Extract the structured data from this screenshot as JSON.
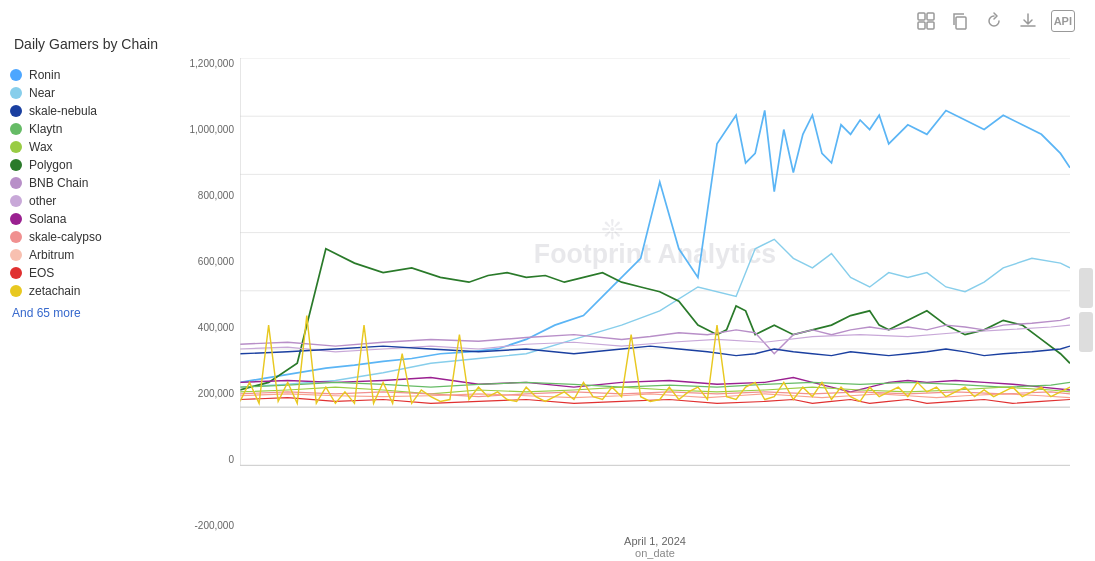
{
  "title": "Daily Gamers by Chain",
  "toolbar": {
    "icons": [
      "table-icon",
      "copy-icon",
      "refresh-icon",
      "download-icon",
      "api-icon"
    ]
  },
  "legend": {
    "items": [
      {
        "label": "Ronin",
        "color": "#4da6ff",
        "id": "ronin"
      },
      {
        "label": "Near",
        "color": "#87ceeb",
        "id": "near"
      },
      {
        "label": "skale-nebula",
        "color": "#1a3fa0",
        "id": "skale-nebula"
      },
      {
        "label": "Klaytn",
        "color": "#66bb66",
        "id": "klaytn"
      },
      {
        "label": "Wax",
        "color": "#99cc44",
        "id": "wax"
      },
      {
        "label": "Polygon",
        "color": "#2a7a2a",
        "id": "polygon"
      },
      {
        "label": "BNB Chain",
        "color": "#b88fc8",
        "id": "bnb-chain"
      },
      {
        "label": "other",
        "color": "#c8a8d8",
        "id": "other"
      },
      {
        "label": "Solana",
        "color": "#9a2090",
        "id": "solana"
      },
      {
        "label": "skale-calypso",
        "color": "#f09090",
        "id": "skale-calypso"
      },
      {
        "label": "Arbitrum",
        "color": "#f8c0b0",
        "id": "arbitrum"
      },
      {
        "label": "EOS",
        "color": "#e03030",
        "id": "eos"
      },
      {
        "label": "zetachain",
        "color": "#e8c820",
        "id": "zetachain"
      }
    ],
    "more": "And 65 more"
  },
  "yAxis": {
    "labels": [
      "1,200,000",
      "1,000,000",
      "800,000",
      "600,000",
      "400,000",
      "200,000",
      "0",
      "-200,000"
    ]
  },
  "xAxis": {
    "label": "April 1, 2024",
    "name": "on_date"
  },
  "watermark": "Footprint Analytics"
}
